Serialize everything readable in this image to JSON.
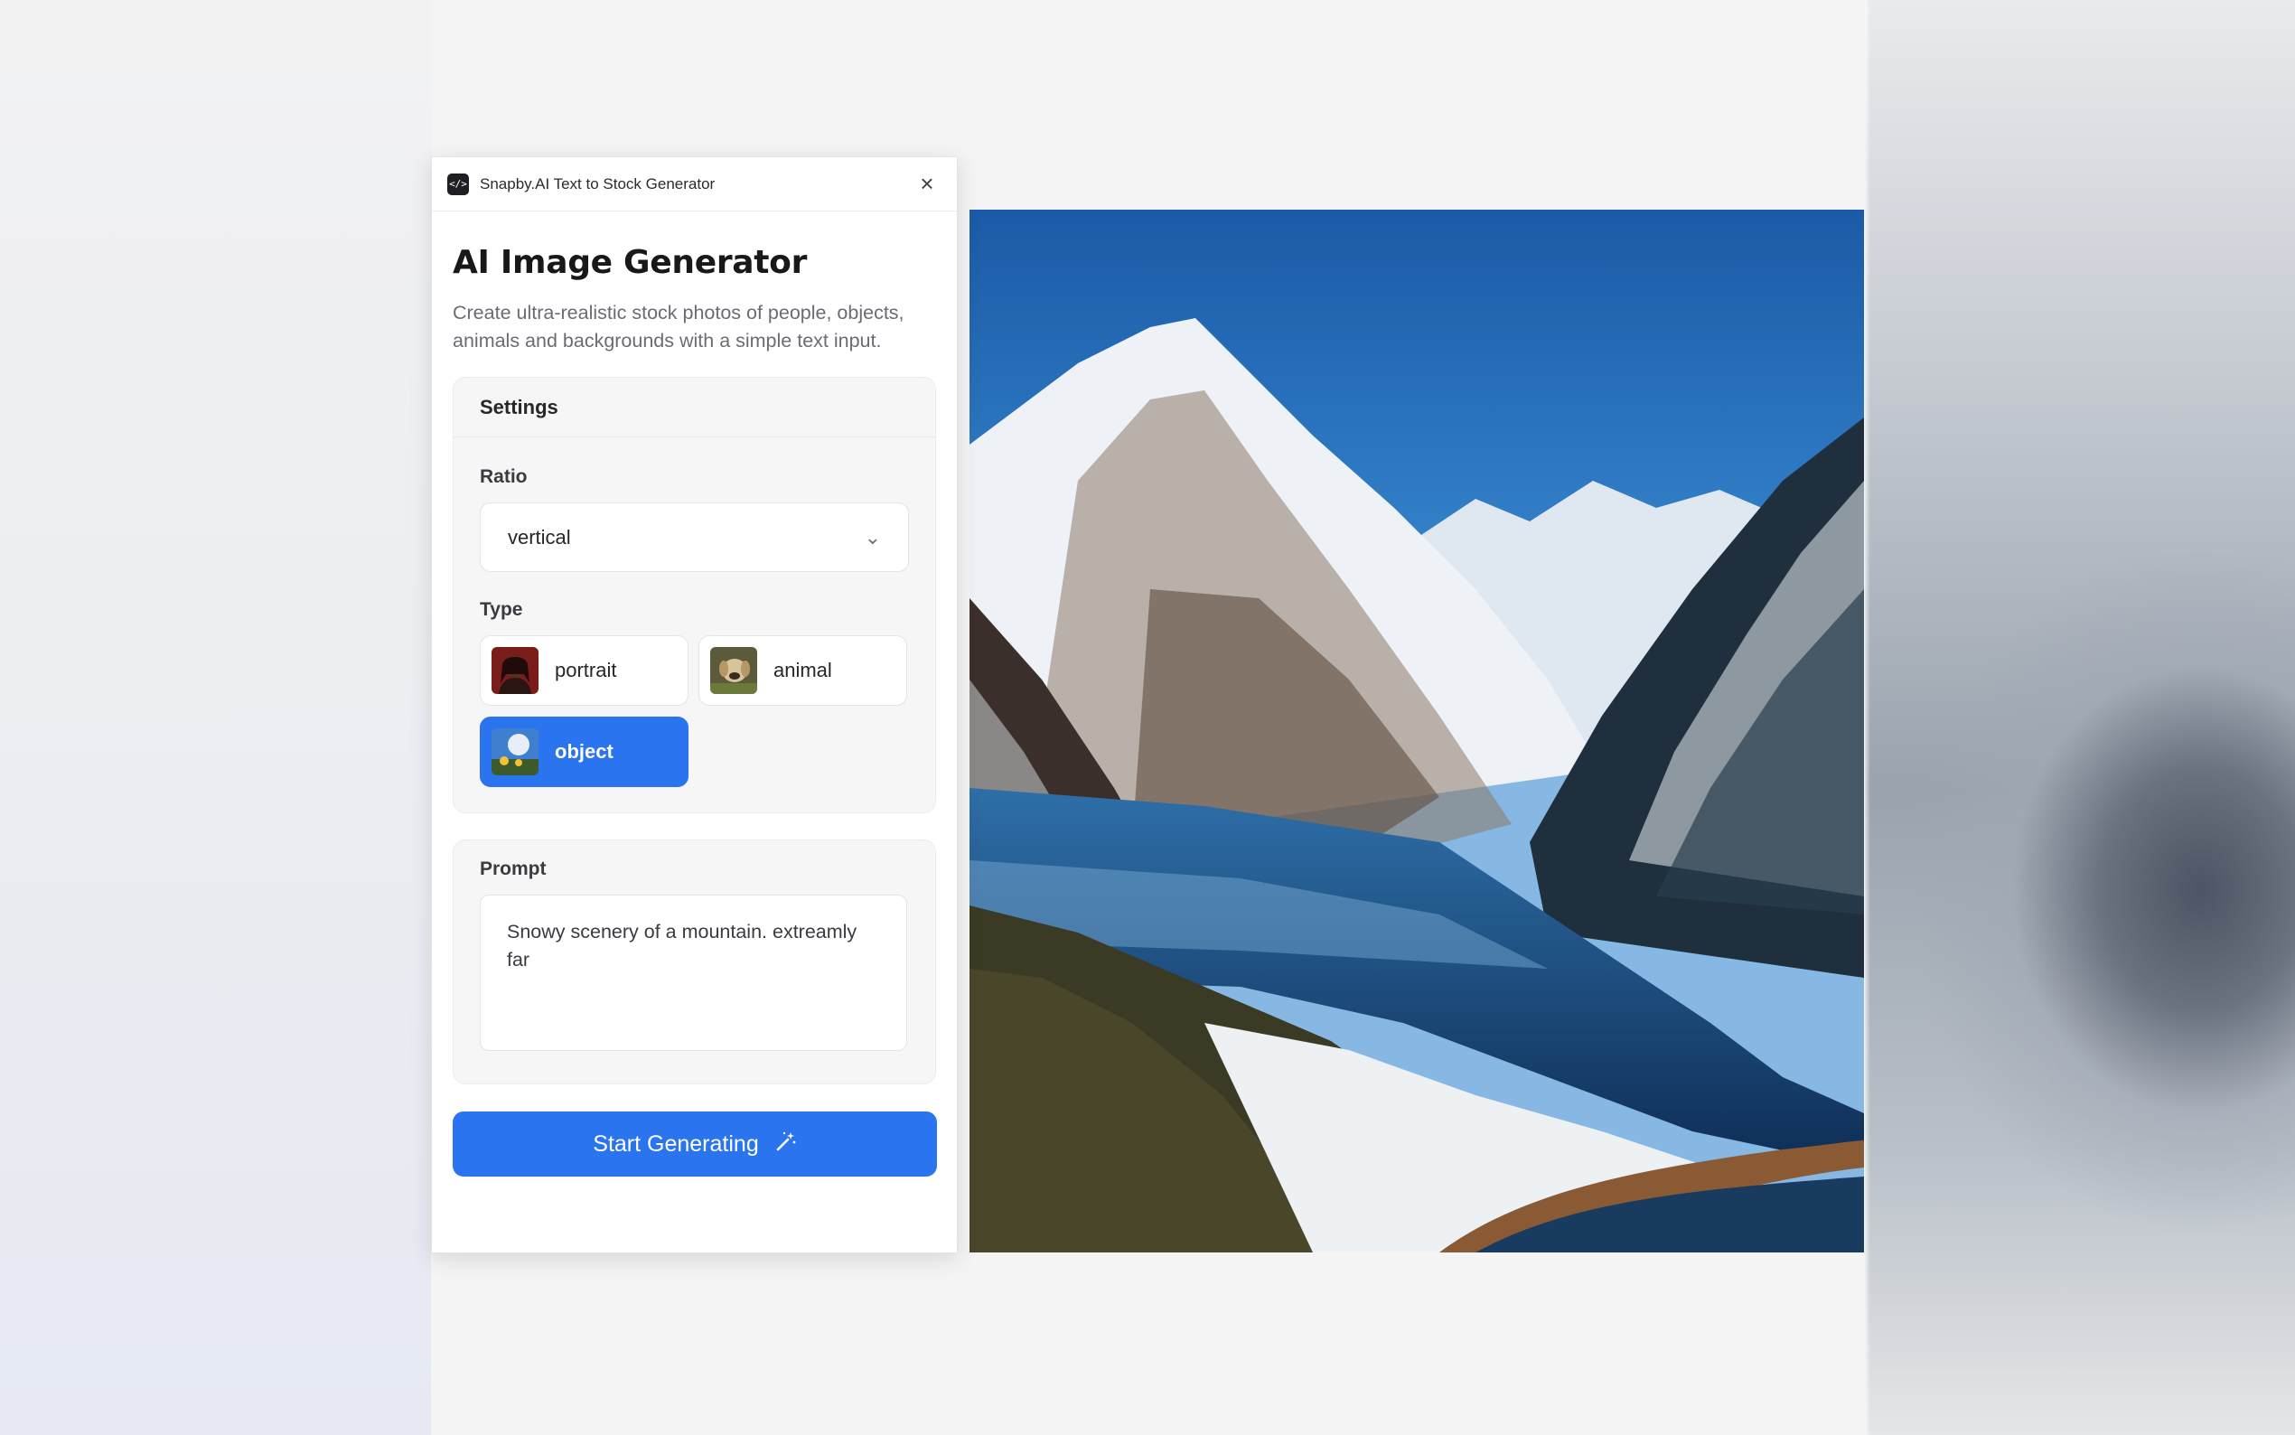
{
  "window": {
    "app_icon": "code-icon",
    "title": "Snapby.AI Text to Stock Generator",
    "close_icon": "close-icon"
  },
  "header": {
    "title": "AI Image Generator",
    "description": "Create ultra-realistic stock photos of people, objects, animals and backgrounds with a simple text input."
  },
  "settings": {
    "heading": "Settings",
    "ratio": {
      "label": "Ratio",
      "selected": "vertical",
      "icon": "chevron-down-icon"
    },
    "type": {
      "label": "Type",
      "options": [
        {
          "label": "portrait",
          "selected": false
        },
        {
          "label": "animal",
          "selected": false
        },
        {
          "label": "object",
          "selected": true
        }
      ]
    }
  },
  "prompt": {
    "label": "Prompt",
    "value": "Snowy scenery of a mountain. extreamly far"
  },
  "generate_button": {
    "label": "Start Generating",
    "icon": "magic-wand-icon"
  },
  "colors": {
    "accent": "#2b74f0",
    "panel_bg": "#ffffff",
    "card_bg": "#f6f6f7"
  }
}
